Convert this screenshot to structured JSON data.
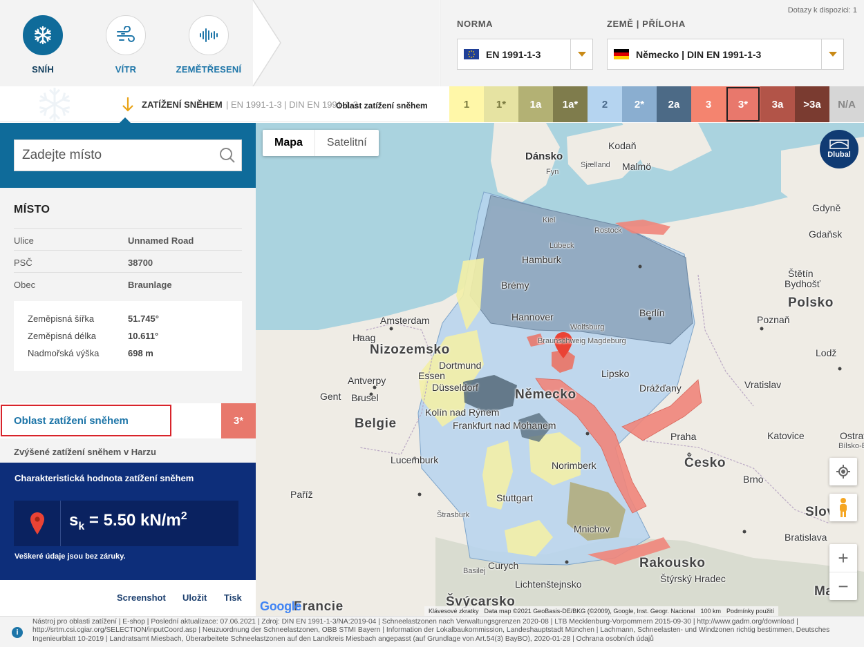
{
  "header": {
    "modes": [
      {
        "label": "SNÍH",
        "icon": "snowflake-icon",
        "active": true
      },
      {
        "label": "VÍTR",
        "icon": "wind-icon",
        "active": false
      },
      {
        "label": "ZEMĚTŘESENÍ",
        "icon": "seismic-wave-icon",
        "active": false
      }
    ],
    "queries_left": "Dotazy k dispozici: 1",
    "norm_label": "NORMA",
    "norm_value": "EN 1991-1-3",
    "country_label": "ZEMĚ | PŘÍLOHA",
    "country_value": "Německo | DIN EN 1991-1-3"
  },
  "zonebar": {
    "title": "ZATÍŽENÍ SNĚHEM",
    "subtitle": "|  EN 1991-1-3  |  DIN EN 1991-1-3",
    "legend_label": "Oblast zatížení sněhem",
    "zones": [
      {
        "label": "1",
        "color": "#fff7a8",
        "text": "#7a7a40"
      },
      {
        "label": "1*",
        "color": "#e6e3a2",
        "text": "#7a7a40"
      },
      {
        "label": "1a",
        "color": "#b3b174",
        "text": "#ffffff"
      },
      {
        "label": "1a*",
        "color": "#7f7c4c",
        "text": "#ffffff"
      },
      {
        "label": "2",
        "color": "#b5d4f0",
        "text": "#4a6a8a"
      },
      {
        "label": "2*",
        "color": "#8aaed0",
        "text": "#ffffff"
      },
      {
        "label": "2a",
        "color": "#4c6a86",
        "text": "#ffffff"
      },
      {
        "label": "3",
        "color": "#f4846f",
        "text": "#ffffff"
      },
      {
        "label": "3*",
        "color": "#e8786c",
        "text": "#ffffff",
        "selected": true
      },
      {
        "label": "3a",
        "color": "#b25448",
        "text": "#ffffff"
      },
      {
        "label": ">3a",
        "color": "#7a3b30",
        "text": "#ffffff"
      },
      {
        "label": "N/A",
        "color": "#d6d6d6",
        "text": "#888888"
      }
    ]
  },
  "panel": {
    "search_placeholder": "Zadejte místo",
    "location_title": "MÍSTO",
    "street_label": "Ulice",
    "street_value": "Unnamed Road",
    "zip_label": "PSČ",
    "zip_value": "38700",
    "city_label": "Obec",
    "city_value": "Braunlage",
    "lat_label": "Zeměpisná šířka",
    "lat_value": "51.745°",
    "lon_label": "Zeměpisná délka",
    "lon_value": "10.611°",
    "alt_label": "Nadmořská výška",
    "alt_value": "698 m",
    "zone_label": "Oblast zatížení sněhem",
    "zone_value": "3*",
    "zone_description": "Zvýšené zatížení sněhem v Harzu",
    "char_title": "Charakteristická hodnota zatížení sněhem",
    "sk_symbol": "s",
    "sk_sub": "k",
    "sk_eq": " = 5.50 kN/m",
    "sk_sup": "2",
    "disclaimer": "Veškeré údaje jsou bez záruky.",
    "actions": [
      "Screenshot",
      "Uložit",
      "Tisk"
    ]
  },
  "map": {
    "btn_map": "Mapa",
    "btn_sat": "Satelitní",
    "logo_text": "Dlubal",
    "google": "Google",
    "attribution": [
      "Klávesové zkratky",
      "Data map ©2021 GeoBasis-DE/BKG (©2009), Google, Inst. Geogr. Nacional",
      "100 km",
      "Podmínky použití"
    ],
    "labels": [
      {
        "t": "Dánsko",
        "c": "big"
      },
      {
        "t": "Fyn",
        "c": "small"
      },
      {
        "t": "Sjælland",
        "c": "small"
      },
      {
        "t": "Kodaň",
        "c": "city"
      },
      {
        "t": "Malmö",
        "c": "city"
      },
      {
        "t": "Kiel",
        "c": "small"
      },
      {
        "t": "Rostock",
        "c": "small"
      },
      {
        "t": "Gdyně",
        "c": "city"
      },
      {
        "t": "Gdaňsk",
        "c": "city"
      },
      {
        "t": "Lübeck",
        "c": "small"
      },
      {
        "t": "Hamburk",
        "c": "city"
      },
      {
        "t": "Štětín",
        "c": "city"
      },
      {
        "t": "Brémy",
        "c": "city"
      },
      {
        "t": "Bydhošť",
        "c": "city"
      },
      {
        "t": "Polsko",
        "c": "country"
      },
      {
        "t": "Hannover",
        "c": "city"
      },
      {
        "t": "Wolfsburg",
        "c": "small"
      },
      {
        "t": "Berlín",
        "c": "city"
      },
      {
        "t": "Amsterdam",
        "c": "city"
      },
      {
        "t": "Poznaň",
        "c": "city"
      },
      {
        "t": "Haag",
        "c": "city"
      },
      {
        "t": "Braunschweig",
        "c": "small"
      },
      {
        "t": "Magdeburg",
        "c": "small"
      },
      {
        "t": "Nizozemsko",
        "c": "country"
      },
      {
        "t": "Lodž",
        "c": "city"
      },
      {
        "t": "Dortmund",
        "c": "city"
      },
      {
        "t": "Essen",
        "c": "city"
      },
      {
        "t": "Lipsko",
        "c": "city"
      },
      {
        "t": "Antverpy",
        "c": "city"
      },
      {
        "t": "Düsseldorf",
        "c": "city"
      },
      {
        "t": "Drážďany",
        "c": "city"
      },
      {
        "t": "Vratislav",
        "c": "city"
      },
      {
        "t": "Gent",
        "c": "city"
      },
      {
        "t": "Brusel",
        "c": "city"
      },
      {
        "t": "Německo",
        "c": "country"
      },
      {
        "t": "Kolín nad Rýnem",
        "c": "city"
      },
      {
        "t": "Belgie",
        "c": "country"
      },
      {
        "t": "Frankfurt nad Mohanem",
        "c": "city"
      },
      {
        "t": "Katovice",
        "c": "city"
      },
      {
        "t": "Ostrava",
        "c": "city"
      },
      {
        "t": "Praha",
        "c": "city"
      },
      {
        "t": "Bílsko-Bělá",
        "c": "small"
      },
      {
        "t": "Lucemburk",
        "c": "city"
      },
      {
        "t": "Česko",
        "c": "country"
      },
      {
        "t": "Norimberk",
        "c": "city"
      },
      {
        "t": "Paříž",
        "c": "city"
      },
      {
        "t": "Stuttgart",
        "c": "city"
      },
      {
        "t": "Brno",
        "c": "city"
      },
      {
        "t": "Štrasburk",
        "c": "small"
      },
      {
        "t": "Mnichov",
        "c": "city"
      },
      {
        "t": "Bratislava",
        "c": "city"
      },
      {
        "t": "Slov",
        "c": "country"
      },
      {
        "t": "Curych",
        "c": "city"
      },
      {
        "t": "Basilej",
        "c": "small"
      },
      {
        "t": "Rakousko",
        "c": "country"
      },
      {
        "t": "Lichtenštejnsko",
        "c": "city"
      },
      {
        "t": "Štýrský Hradec",
        "c": "city"
      },
      {
        "t": "Švýcarsko",
        "c": "country"
      },
      {
        "t": "Francie",
        "c": "country"
      },
      {
        "t": "Ma",
        "c": "country"
      }
    ]
  },
  "footer": {
    "text": "Nástroj pro oblasti zatížení  |  E-shop  |  Poslední aktualizace: 07.06.2021  |  Zdroj: DIN EN 1991-1-3/NA:2019-04  |  Schneelastzonen nach Verwaltungsgrenzen 2020-08  |  LTB Mecklenburg-Vorpommern 2015-09-30  |  http://www.gadm.org/download  |  http://srtm.csi.cgiar.org/SELECTION/inputCoord.asp  |  Neuzuordnung der Schneelastzonen, OBB STMI Bayern  |  Information der Lokalbaukommission, Landeshauptstadt München  |  Lachmann, Schneelasten- und Windzonen richtig bestimmen, Deutsches Ingenieurblatt 10-2019  |  Landratsamt Miesbach, Überarbeitete Schneelastzonen auf den Landkreis Miesbach angepasst (auf Grundlage von Art.54(3) BayBO), 2020-01-28  |  Ochrana osobních údajů"
  }
}
